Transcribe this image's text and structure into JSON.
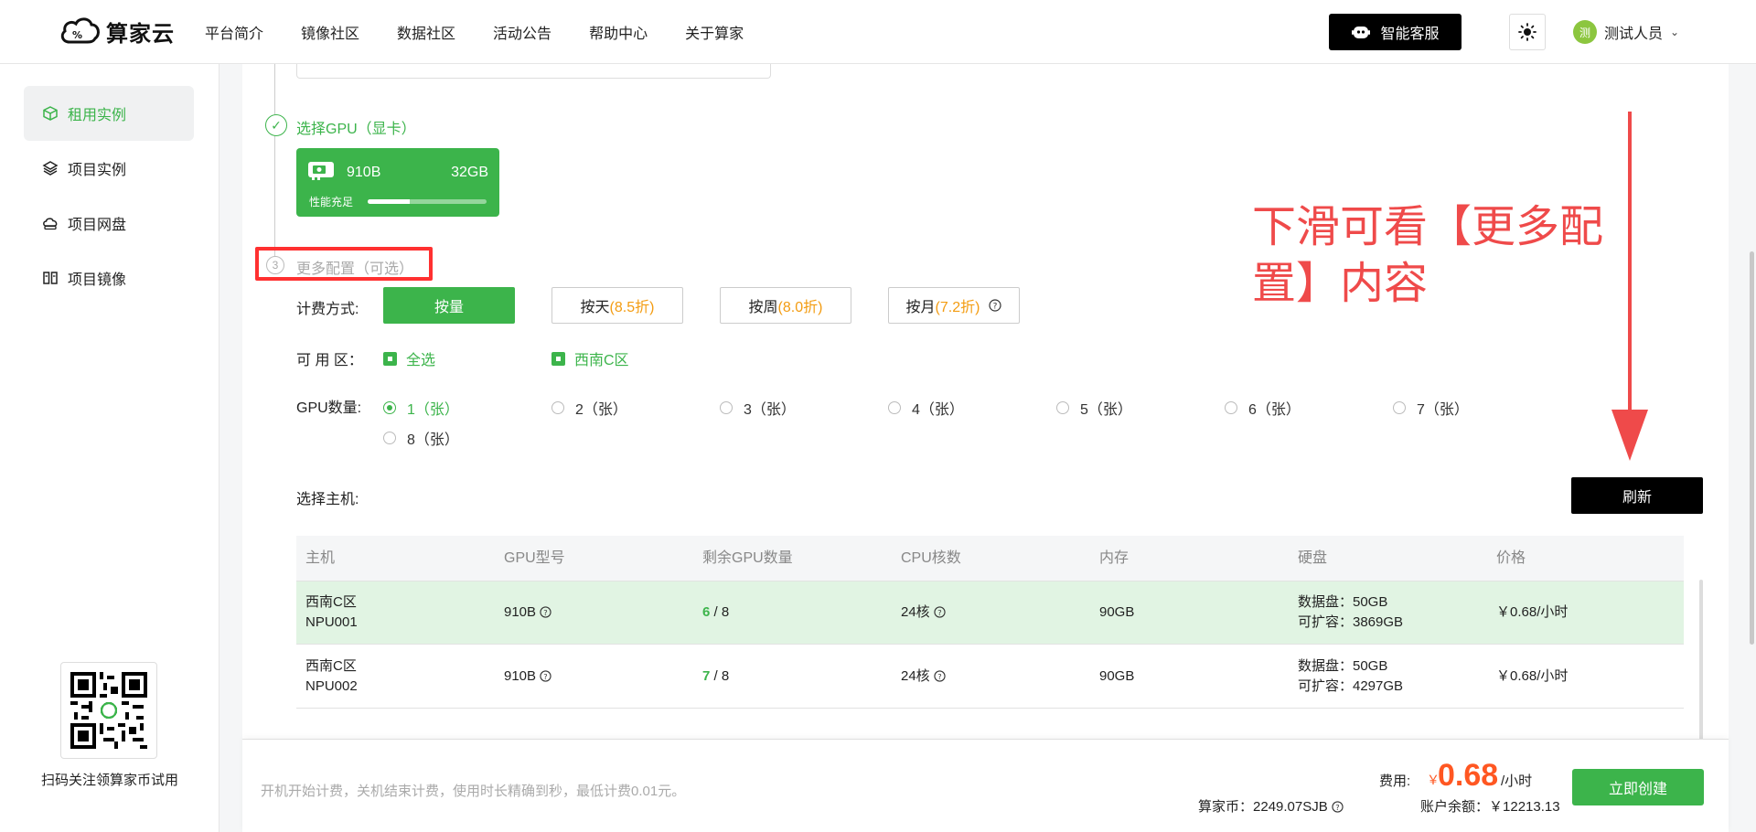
{
  "header": {
    "logo_text": "算家云",
    "nav": [
      "平台简介",
      "镜像社区",
      "数据社区",
      "活动公告",
      "帮助中心",
      "关于算家"
    ],
    "service_label": "智能客服",
    "user_name": "测试人员",
    "avatar_char": "测"
  },
  "sidebar": {
    "items": [
      {
        "label": "租用实例",
        "icon": "cube-icon",
        "active": true
      },
      {
        "label": "项目实例",
        "icon": "layers-icon",
        "active": false
      },
      {
        "label": "项目网盘",
        "icon": "cloud-disk-icon",
        "active": false
      },
      {
        "label": "项目镜像",
        "icon": "image-icon",
        "active": false
      }
    ],
    "qr_caption": "扫码关注领算家币试用"
  },
  "steps": {
    "gpu_title": "选择GPU（显卡）",
    "gpu_card": {
      "name": "910B",
      "memory": "32GB",
      "perf_label": "性能充足",
      "perf_level": 0.35
    },
    "more_num": "3",
    "more_title": "更多配置（可选）"
  },
  "billing": {
    "label": "计费方式:",
    "options": [
      {
        "label": "按量",
        "discount": "",
        "active": true
      },
      {
        "label": "按天",
        "discount": "(8.5折)",
        "active": false
      },
      {
        "label": "按周",
        "discount": "(8.0折)",
        "active": false
      },
      {
        "label": "按月",
        "discount": "(7.2折)",
        "active": false
      }
    ]
  },
  "zone": {
    "label": "可 用 区：",
    "options": [
      "全选",
      "西南C区"
    ]
  },
  "gpu_count": {
    "label": "GPU数量:",
    "options": [
      "1（张）",
      "2（张）",
      "3（张）",
      "4（张）",
      "5（张）",
      "6（张）",
      "7（张）",
      "8（张）"
    ],
    "selected": "1（张）"
  },
  "host": {
    "label": "选择主机:",
    "refresh_label": "刷新",
    "columns": [
      "主机",
      "GPU型号",
      "剩余GPU数量",
      "CPU核数",
      "内存",
      "硬盘",
      "价格"
    ],
    "rows": [
      {
        "zone": "西南C区",
        "host": "NPU001",
        "gpu": "910B",
        "free": "6",
        "total": "/ 8",
        "cpu": "24核",
        "mem": "90GB",
        "disk1": "数据盘：50GB",
        "disk2": "可扩容：3869GB",
        "price": "￥0.68/小时",
        "selected": true
      },
      {
        "zone": "西南C区",
        "host": "NPU002",
        "gpu": "910B",
        "free": "7",
        "total": "/ 8",
        "cpu": "24核",
        "mem": "90GB",
        "disk1": "数据盘：50GB",
        "disk2": "可扩容：4297GB",
        "price": "￥0.68/小时",
        "selected": false
      }
    ]
  },
  "annotation": {
    "line1": "下滑可看【更多配",
    "line2": "置】内容",
    "color": "#ef4a4a"
  },
  "footer": {
    "note": "开机开始计费，关机结束计费，使用时长精确到秒，最低计费0.01元。",
    "fee_label": "费用:",
    "currency": "￥",
    "fee_value": "0.68",
    "fee_unit": "/小时",
    "coins_label": "算家币：",
    "coins_value": "2249.07SJB",
    "balance_label": "账户余额：",
    "balance_value": "￥12213.13",
    "create_label": "立即创建"
  },
  "colors": {
    "accent": "#3cb44b",
    "price": "#ff5722",
    "discount": "#f39c12",
    "highlight": "#ff3030"
  }
}
